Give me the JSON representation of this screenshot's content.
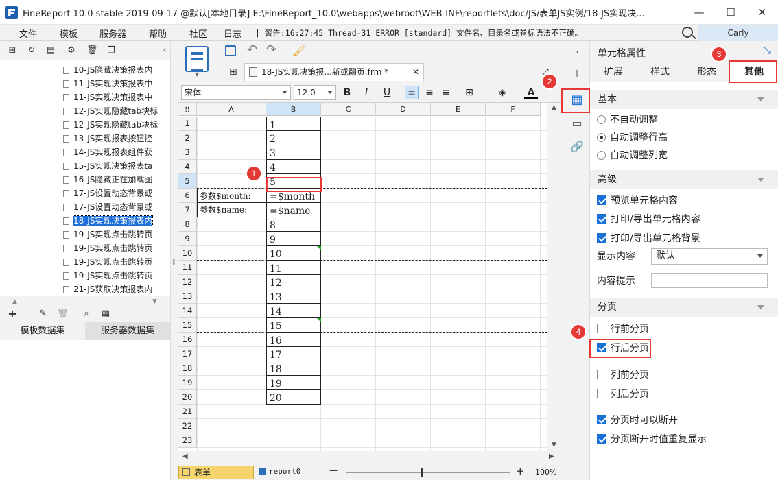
{
  "window": {
    "title": "FineReport 10.0 stable 2019-09-17 @默认[本地目录]    E:\\FineReport_10.0\\webapps\\webroot\\WEB-INF\\reportlets\\doc/JS/表单JS实例/18-JS实现决...",
    "minimize": "—",
    "maximize": "☐",
    "close": "✕"
  },
  "menu": {
    "items": [
      "文件",
      "模板",
      "服务器",
      "帮助",
      "社区",
      "日志"
    ],
    "log_text": "| 警告:16:27:45 Thread-31 ERROR [standard] 文件名、目录名或卷标语法不正确。",
    "user": "Carly"
  },
  "tree": {
    "items": [
      "10-JS隐藏决策报表内",
      "11-JS实现决策报表中",
      "11-JS实现决策报表中",
      "12-JS实现隐藏tab块标",
      "12-JS实现隐藏tab块标",
      "13-JS实现报表按钮控",
      "14-JS实现报表组件获",
      "15-JS实现决策报表ta",
      "16-JS隐藏正在加载图",
      "17-JS设置动态背景或",
      "17-JS设置动态背景或",
      "18-JS实现决策报表内",
      "19-JS实现点击跳转页",
      "19-JS实现点击跳转页",
      "19-JS实现点击跳转页",
      "19-JS实现点击跳转页",
      "21-JS获取决策报表内"
    ],
    "selected_index": 11
  },
  "dataset_tabs": [
    "模板数据集",
    "服务器数据集"
  ],
  "file_tab": {
    "label": "18-JS实现决策报...新或翻页.frm *",
    "close": "✕"
  },
  "format": {
    "font": "宋体",
    "size": "12.0",
    "bold": "B",
    "italic": "I",
    "underline": "U",
    "font_color": "A"
  },
  "grid": {
    "columns": [
      "A",
      "B",
      "C",
      "D",
      "E",
      "F"
    ],
    "rows": [
      "1",
      "2",
      "3",
      "4",
      "5",
      "6",
      "7",
      "8",
      "9",
      "10",
      "11",
      "12",
      "13",
      "14",
      "15",
      "16",
      "17",
      "18",
      "19",
      "20",
      "21",
      "22",
      "23"
    ],
    "b_values": [
      "1",
      "2",
      "3",
      "4",
      "5",
      "=$month",
      "=$name",
      "8",
      "9",
      "10",
      "11",
      "12",
      "13",
      "14",
      "15",
      "16",
      "17",
      "18",
      "19",
      "20"
    ],
    "a6": "参数$month:",
    "a7": "参数$name:"
  },
  "status": {
    "sheet_tab": "表单",
    "report_tab": "report0",
    "zoom": "100%",
    "minus": "—",
    "plus": "+"
  },
  "right_panel": {
    "title": "单元格属性",
    "tabs": [
      "扩展",
      "样式",
      "形态",
      "其他"
    ],
    "active_tab": "其他",
    "basic": {
      "title": "基本",
      "options": [
        "不自动调整",
        "自动调整行高",
        "自动调整列宽"
      ],
      "selected": 1
    },
    "advanced": {
      "title": "高级",
      "checks": [
        "预览单元格内容",
        "打印/导出单元格内容",
        "打印/导出单元格背景"
      ],
      "display_label": "显示内容",
      "display_value": "默认",
      "tooltip_label": "内容提示",
      "tooltip_value": ""
    },
    "paging": {
      "title": "分页",
      "options": [
        "行前分页",
        "行后分页",
        "列前分页",
        "列后分页",
        "分页时可以断开",
        "分页断开时值重复显示"
      ],
      "checked": [
        false,
        true,
        false,
        false,
        true,
        true
      ]
    }
  },
  "annotations": [
    "1",
    "2",
    "3",
    "4"
  ],
  "colors": {
    "accent": "#1a6fd8",
    "highlight": "#e53935",
    "selected_header": "#cfe5f7"
  }
}
